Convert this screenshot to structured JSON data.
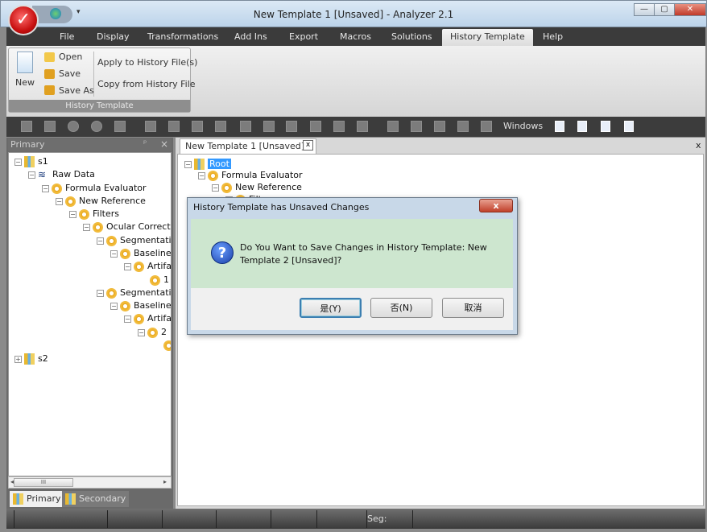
{
  "window": {
    "title": "New Template 1 [Unsaved] - Analyzer 2.1",
    "minimize": "—",
    "restore": "▢",
    "close": "✕"
  },
  "app_button": {
    "glyph": "✓"
  },
  "qat": {
    "dropdown": "▾"
  },
  "menu": [
    "File",
    "Display",
    "Transformations",
    "Add Ins",
    "Export",
    "Macros",
    "Solutions",
    "History Template",
    "Help"
  ],
  "menu_active": "History Template",
  "ribbon": {
    "new": "New",
    "open": "Open",
    "save": "Save",
    "save_as": "Save As",
    "apply": "Apply to History File(s)",
    "copy": "Copy from History File",
    "group_label": "History Template"
  },
  "toolbar": {
    "windows_label": "Windows"
  },
  "left_panel": {
    "title": "Primary",
    "pin": "ᵖ",
    "close": "×",
    "scroll_thumb": "III",
    "scroll_left": "◂",
    "scroll_right": "▸",
    "tree": [
      "s1",
      "Raw Data",
      "Formula Evaluator",
      "New Reference",
      "Filters",
      "Ocular Correction",
      "Segmentation",
      "Baseline",
      "Artifact",
      "1",
      "Segmentation",
      "Baseline",
      "Artifact",
      "2",
      "",
      "s2"
    ],
    "tabs": [
      "Primary",
      "Secondary"
    ]
  },
  "document": {
    "tab_label": "New Template 1 [Unsaved]",
    "tab_close": "x",
    "close_all": "x",
    "tree": [
      "Root",
      "Formula Evaluator",
      "New Reference",
      "Filters"
    ]
  },
  "dialog": {
    "title": "History Template has Unsaved Changes",
    "close": "x",
    "message": "Do You Want to Save Changes in History Template: New Template 2 [Unsaved]?",
    "icon": "?",
    "yes": "是(Y)",
    "no": "否(N)",
    "cancel": "取消"
  },
  "status": {
    "seg_label": "Seg:"
  },
  "colors": {
    "menubar": "#3b3b3b",
    "dialog_body": "#cde6cf",
    "selection": "#3399ff"
  }
}
